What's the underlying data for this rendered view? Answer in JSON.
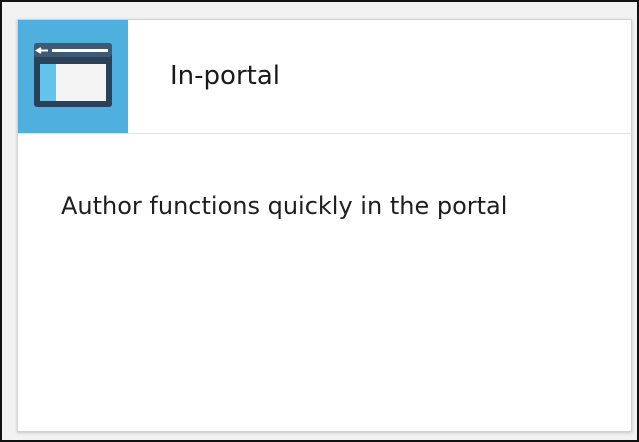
{
  "card": {
    "title": "In-portal",
    "description": "Author functions quickly in the portal",
    "icon": "browser-window-icon"
  },
  "colors": {
    "icon_tile_background": "#4fb0e0",
    "card_background": "#ffffff",
    "card_border": "#d2d2d2"
  }
}
